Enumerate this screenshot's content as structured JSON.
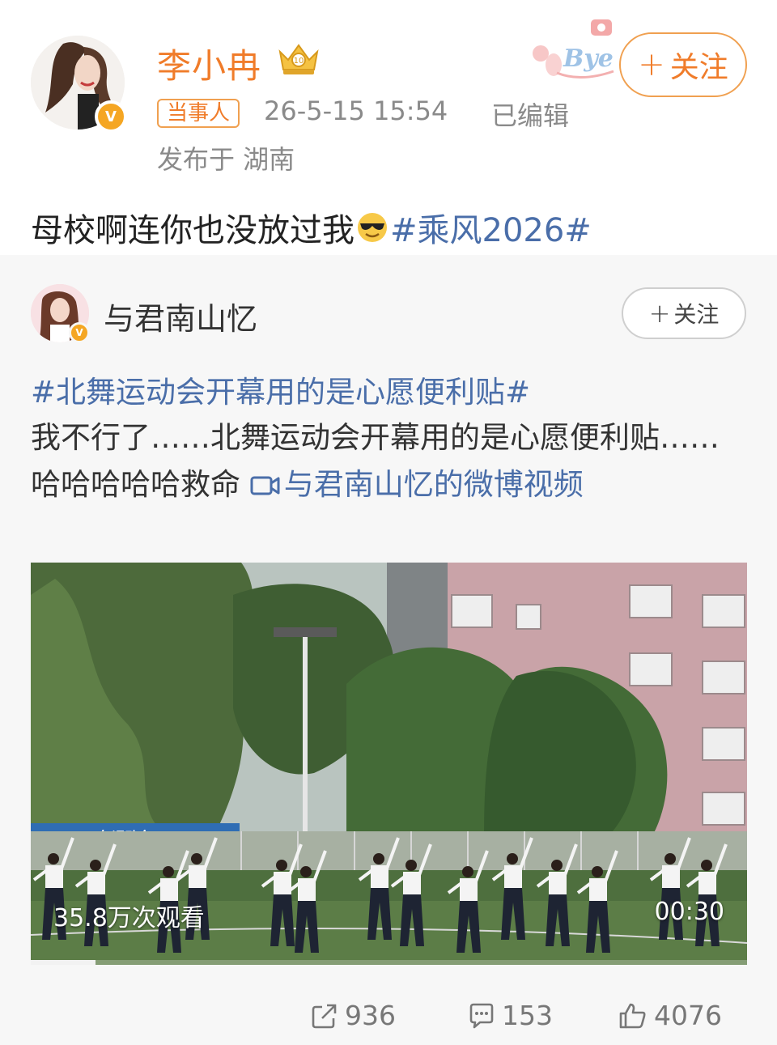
{
  "post": {
    "author": "李小冉",
    "follow_label": "关注",
    "tag": "当事人",
    "time": "26-5-15 15:54",
    "edited": "已编辑",
    "location": "发布于 湖南",
    "text": "母校啊连你也没放过我",
    "emoji": "sunglasses-emoji",
    "hashtag": "#乘风2026#"
  },
  "repost": {
    "author": "与君南山忆",
    "follow_label": "关注",
    "hashtag": "#北舞运动会开幕用的是心愿便利贴#",
    "body": "我不行了……北舞运动会开幕用的是心愿便利贴……哈哈哈哈哈救命",
    "video_link": "与君南山忆的微博视频",
    "video": {
      "views": "35.8万次观看",
      "duration": "00:30",
      "banner_text": "2026年运动会",
      "progress": 0.09
    },
    "actions": {
      "reposts": "936",
      "comments": "153",
      "likes": "4076"
    }
  },
  "colors": {
    "accent": "#f07c2a",
    "link": "#4a6ea9",
    "meta": "#8a8a8a"
  }
}
